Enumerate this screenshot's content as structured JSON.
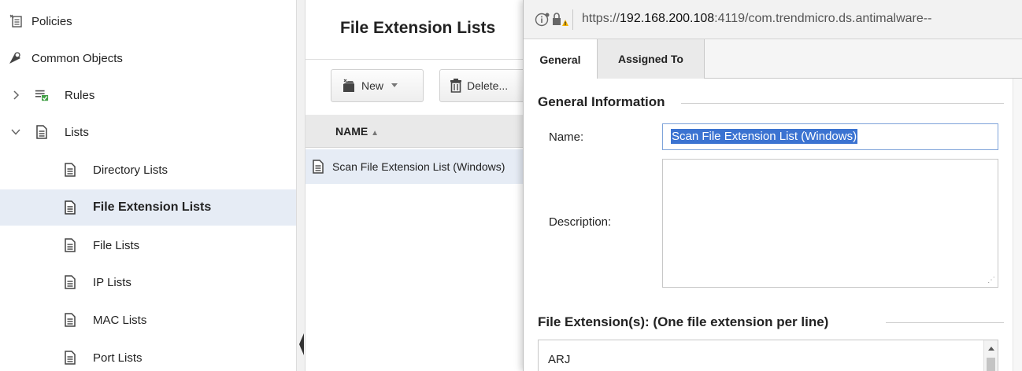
{
  "sidebar": {
    "items": [
      {
        "label": "Policies"
      },
      {
        "label": "Common Objects"
      },
      {
        "label": "Rules"
      },
      {
        "label": "Lists"
      },
      {
        "label": "Directory Lists"
      },
      {
        "label": "File Extension Lists"
      },
      {
        "label": "File Lists"
      },
      {
        "label": "IP Lists"
      },
      {
        "label": "MAC Lists"
      },
      {
        "label": "Port Lists"
      }
    ],
    "selected": "File Extension Lists"
  },
  "center": {
    "title": "File Extension Lists",
    "toolbar": {
      "new_label": "New",
      "delete_label": "Delete..."
    },
    "column_header": "NAME",
    "rows": [
      {
        "name": "Scan File Extension List (Windows)"
      }
    ]
  },
  "dialog": {
    "url_prefix": "https://",
    "url_host": "192.168.200.108",
    "url_rest": ":4119/com.trendmicro.ds.antimalware--",
    "tabs": [
      {
        "label": "General"
      },
      {
        "label": "Assigned To"
      }
    ],
    "active_tab": "General",
    "general_section_title": "General Information",
    "name_label": "Name:",
    "name_value": "Scan File Extension List (Windows)",
    "description_label": "Description:",
    "description_value": "",
    "extensions_section_title": "File Extension(s): (One file extension per line)",
    "extensions_first_line": "ARJ"
  },
  "colors": {
    "selection_bg": "#e6ecf5",
    "text_selection": "#3b73d1",
    "input_focus_border": "#7ea3d9"
  }
}
